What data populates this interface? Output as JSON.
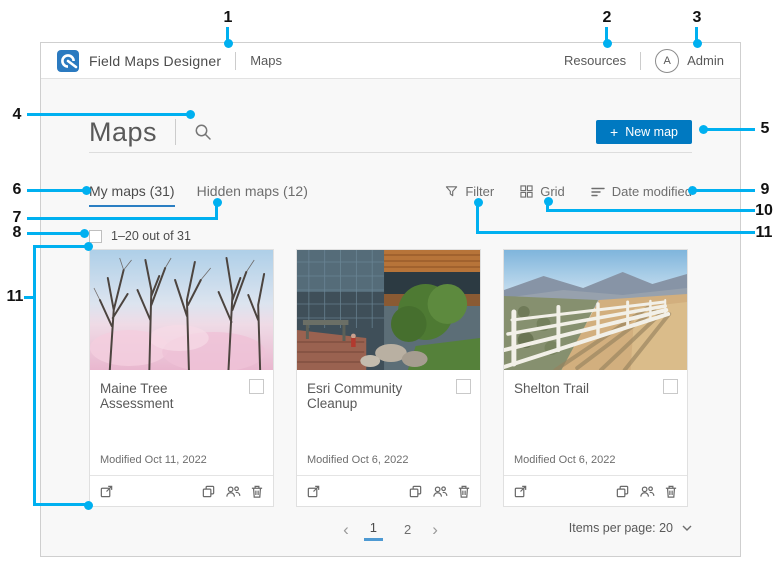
{
  "colors": {
    "accent_blue": "#0079c1",
    "callout_cyan": "#00b0f0",
    "tab_underline_blue": "#2b7fc3",
    "content_background": "#f8f8f8"
  },
  "callouts": {
    "labels": {
      "c1": "1",
      "c2": "2",
      "c3": "3",
      "c4": "4",
      "c5": "5",
      "c6": "6",
      "c7": "7",
      "c8": "8",
      "c9": "9",
      "c10": "10",
      "c11": "11"
    }
  },
  "header": {
    "brand": "Field Maps Designer",
    "nav": "Maps",
    "resources": "Resources",
    "avatar": "A",
    "user": "Admin"
  },
  "main": {
    "title": "Maps",
    "new_map": {
      "icon": "+",
      "label": "New map"
    }
  },
  "tabs": [
    {
      "label": "My maps (31)",
      "active": true
    },
    {
      "label": "Hidden maps (12)",
      "active": false
    }
  ],
  "toolbar": {
    "filter": "Filter",
    "grid": "Grid",
    "sort": "Date modified"
  },
  "selection": {
    "label": "1–20 out of 31"
  },
  "cards": [
    {
      "title": "Maine Tree Assessment",
      "modified": "Modified Oct 11, 2022"
    },
    {
      "title": "Esri Community Cleanup",
      "modified": "Modified Oct 6, 2022"
    },
    {
      "title": "Shelton Trail",
      "modified": "Modified Oct 6, 2022"
    }
  ],
  "pagination": {
    "prev": "‹",
    "pages": [
      "1",
      "2"
    ],
    "active_page": "1",
    "next": "›"
  },
  "items_per_page": {
    "label": "Items per page: 20"
  },
  "icons": {
    "esri-logo": "blue-rounded-square-globe",
    "search": "magnifier",
    "plus": "+",
    "filter": "funnel",
    "grid": "four-squares",
    "sort": "descending-bars",
    "open": "box-with-arrow",
    "duplicate": "overlapping-squares",
    "group": "two-people",
    "delete": "trash-can",
    "chevron-down": "∨",
    "page-prev": "‹",
    "page-next": "›"
  }
}
